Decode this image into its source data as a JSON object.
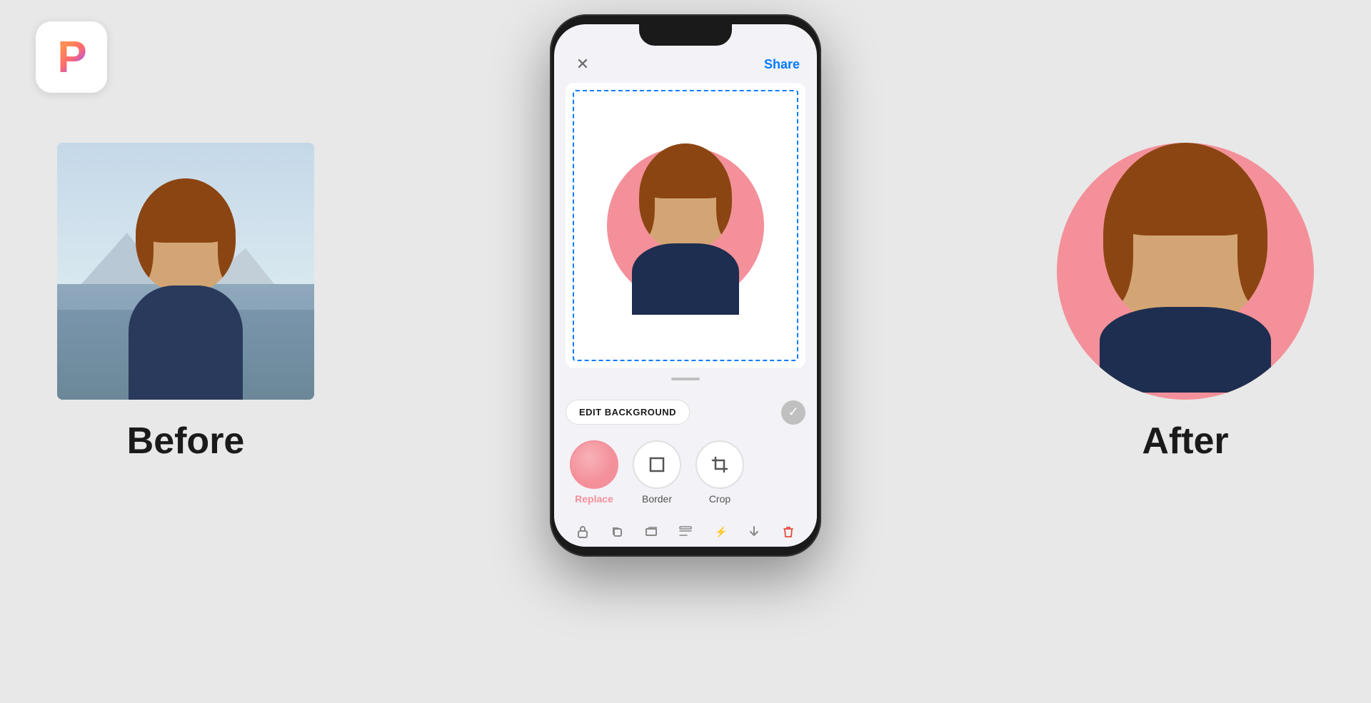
{
  "app": {
    "icon_letter": "P"
  },
  "before": {
    "label": "Before"
  },
  "after": {
    "label": "After"
  },
  "phone": {
    "close_symbol": "✕",
    "share_label": "Share",
    "edit_background_label": "EDIT BACKGROUND",
    "drag_handle": ""
  },
  "tools": [
    {
      "id": "replace",
      "label": "Replace",
      "active": true
    },
    {
      "id": "border",
      "label": "Border",
      "active": false
    },
    {
      "id": "crop",
      "label": "Crop",
      "active": false
    }
  ],
  "bottom_icons": [
    {
      "id": "lock",
      "symbol": "🔒"
    },
    {
      "id": "copy",
      "symbol": "⧉"
    },
    {
      "id": "layers",
      "symbol": "⊡"
    },
    {
      "id": "align",
      "symbol": "⊟"
    },
    {
      "id": "effects",
      "symbol": "⚡"
    },
    {
      "id": "export",
      "symbol": "▷"
    },
    {
      "id": "trash",
      "symbol": "🗑",
      "accent": true
    }
  ],
  "colors": {
    "background": "#e8e8e8",
    "pink": "#F4909A",
    "blue_dashed": "#007AFF",
    "body_dark": "#1e2e50",
    "phone_bg": "#1a1a1a",
    "screen_bg": "#f2f2f7"
  }
}
